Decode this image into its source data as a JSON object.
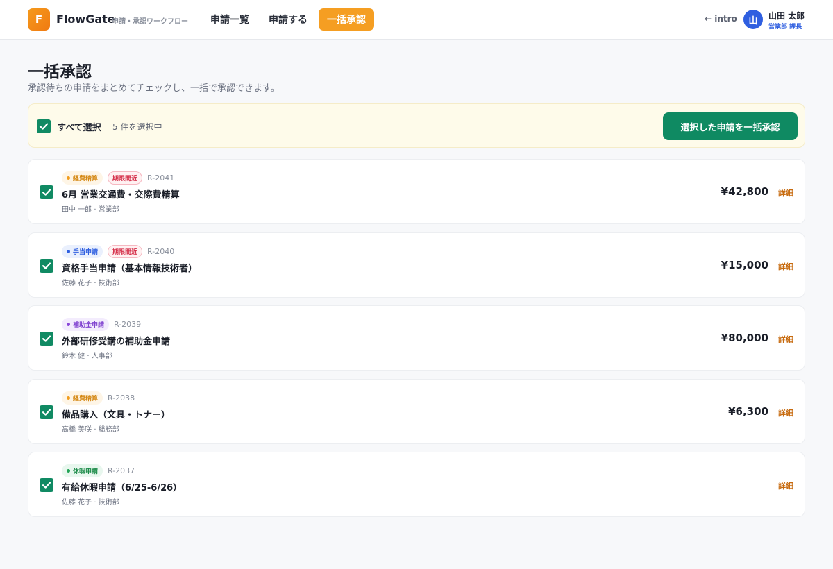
{
  "header": {
    "logo_letter": "F",
    "brand": "FlowGate",
    "brand_sub": "申請・承認ワークフロー",
    "nav": [
      "申請一覧",
      "申請する"
    ],
    "nav_active": "一括承認",
    "intro_link": "← intro",
    "user": {
      "avatar_letter": "山",
      "name": "山田 太郎",
      "role": "営業部 課長"
    }
  },
  "page": {
    "title": "一括承認",
    "subtitle": "承認待ちの申請をまとめてチェックし、一括で承認できます。"
  },
  "select_bar": {
    "select_all_label": "すべて選択",
    "selected_count": "5 件を選択中",
    "bulk_button": "選択した申請を一括承認"
  },
  "detail_label": "詳細",
  "requests": [
    {
      "category": "経費精算",
      "category_color": "orange",
      "deadline": "期限間近",
      "id": "R-2041",
      "title": "6月 営業交通費・交際費精算",
      "meta": "田中 一郎 · 営業部",
      "amount": "¥42,800",
      "checked": true
    },
    {
      "category": "手当申請",
      "category_color": "blue",
      "deadline": "期限間近",
      "id": "R-2040",
      "title": "資格手当申請（基本情報技術者）",
      "meta": "佐藤 花子 · 技術部",
      "amount": "¥15,000",
      "checked": true
    },
    {
      "category": "補助金申請",
      "category_color": "purple",
      "deadline": "",
      "id": "R-2039",
      "title": "外部研修受講の補助金申請",
      "meta": "鈴木 健 · 人事部",
      "amount": "¥80,000",
      "checked": true
    },
    {
      "category": "経費精算",
      "category_color": "orange",
      "deadline": "",
      "id": "R-2038",
      "title": "備品購入（文具・トナー）",
      "meta": "高橋 美咲 · 総務部",
      "amount": "¥6,300",
      "checked": true
    },
    {
      "category": "休暇申請",
      "category_color": "green",
      "deadline": "",
      "id": "R-2037",
      "title": "有給休暇申請（6/25-6/26）",
      "meta": "佐藤 花子 · 技術部",
      "amount": "",
      "checked": true
    }
  ],
  "colors": {
    "accent_orange": "#f59e22",
    "approve_green": "#0f8a62",
    "deadline_red": "#d5304a"
  }
}
